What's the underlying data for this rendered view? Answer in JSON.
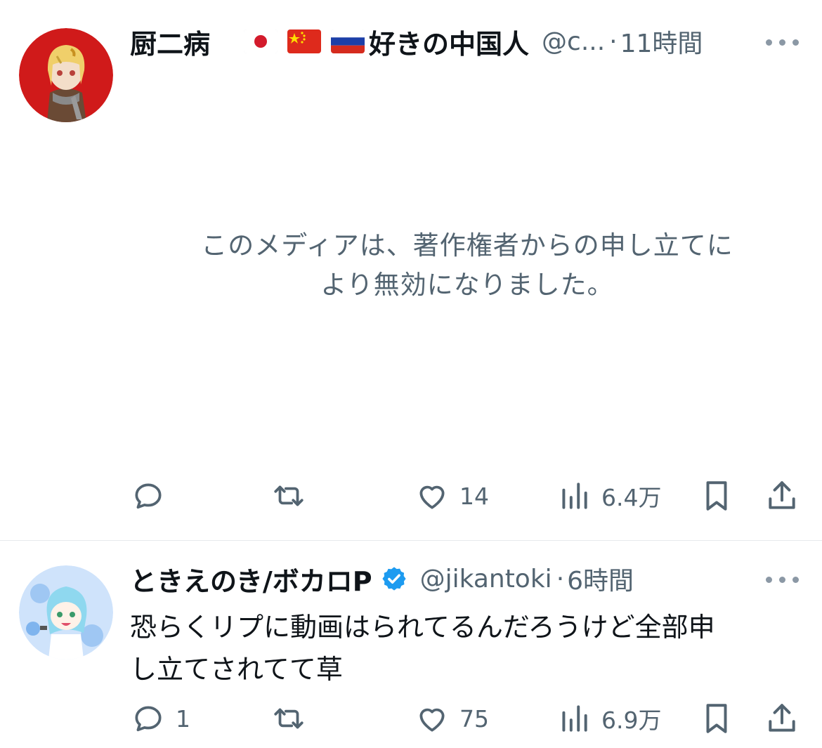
{
  "tweets": [
    {
      "display_name": "厨二病",
      "name_suffix": "好きの中国人",
      "flags": [
        "jp-flag-icon",
        "cn-flag-icon",
        "ru-flag-icon"
      ],
      "handle": "@c...",
      "separator": "·",
      "time": "11時間",
      "media_notice_line1": "このメディアは、著作権者からの申し立てに",
      "media_notice_line2": "より無効になりました。",
      "actions": {
        "replies": "",
        "retweets": "",
        "likes": "14",
        "views": "6.4万"
      }
    },
    {
      "display_name": "ときえのき/ボカロP",
      "verified": true,
      "handle": "@jikantoki",
      "separator": "·",
      "time": "6時間",
      "text_line1": "恐らくリプに動画はられてるんだろうけど全部申",
      "text_line2": "し立てされてて草",
      "actions": {
        "replies": "1",
        "retweets": "",
        "likes": "75",
        "views": "6.9万"
      }
    }
  ],
  "colors": {
    "text": "#0f1419",
    "muted": "#536471",
    "verified_blue": "#1d9bf0",
    "divider": "#e6e9ec"
  }
}
